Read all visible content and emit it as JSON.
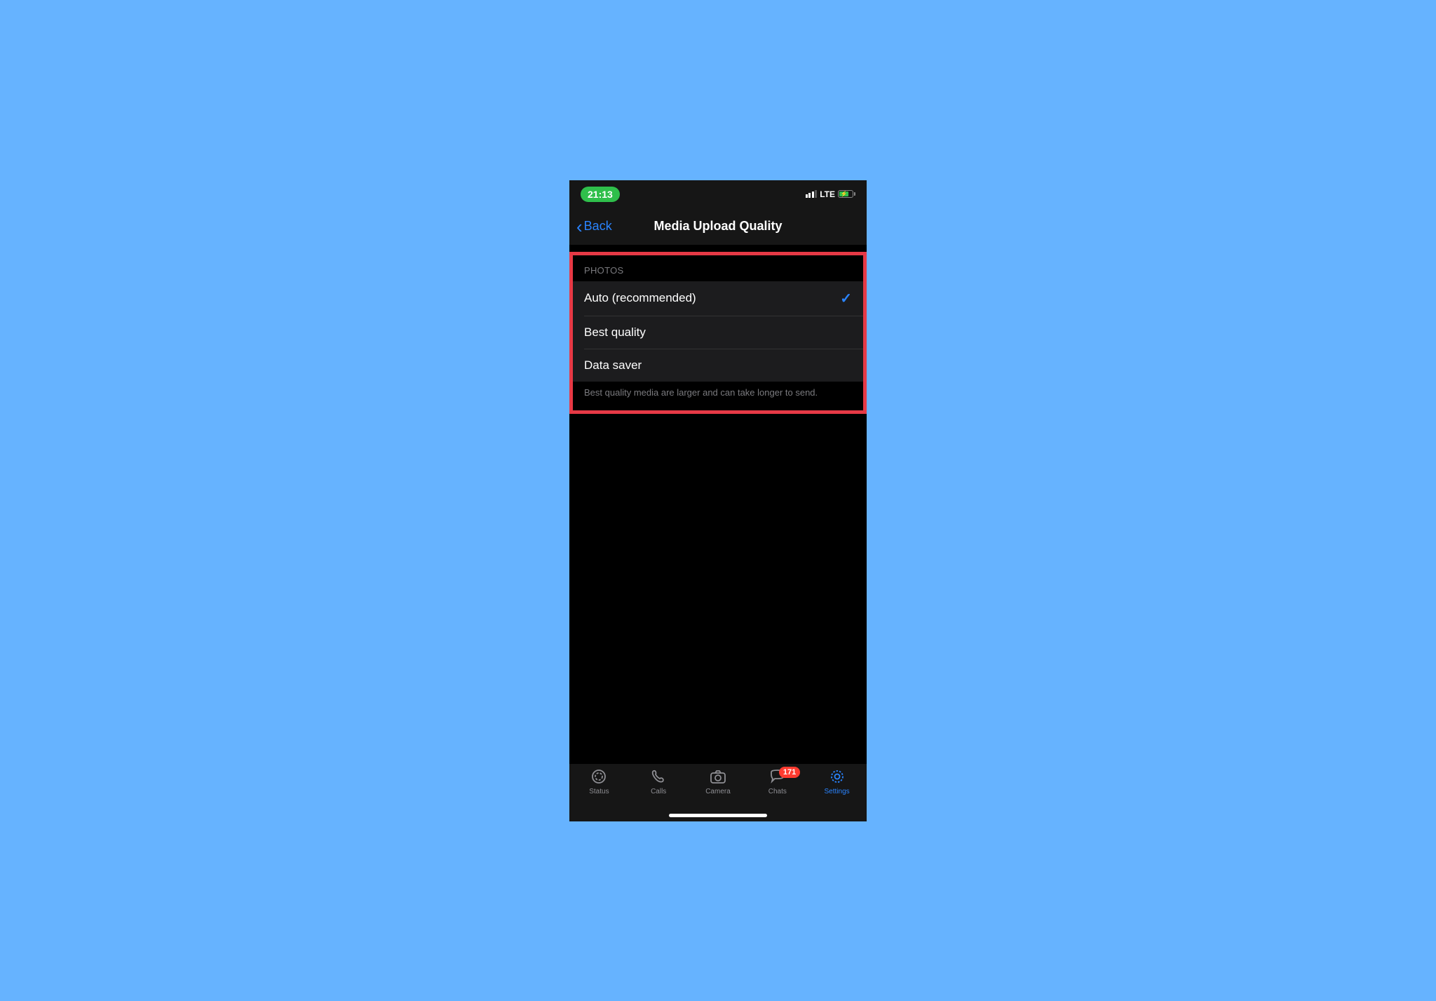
{
  "status": {
    "time": "21:13",
    "network": "LTE"
  },
  "nav": {
    "back_label": "Back",
    "title": "Media Upload Quality"
  },
  "section": {
    "header": "PHOTOS",
    "options": [
      {
        "label": "Auto (recommended)",
        "selected": true
      },
      {
        "label": "Best quality",
        "selected": false
      },
      {
        "label": "Data saver",
        "selected": false
      }
    ],
    "footer": "Best quality media are larger and can take longer to send."
  },
  "tabs": {
    "items": [
      {
        "label": "Status",
        "active": false
      },
      {
        "label": "Calls",
        "active": false
      },
      {
        "label": "Camera",
        "active": false
      },
      {
        "label": "Chats",
        "active": false,
        "badge": "171"
      },
      {
        "label": "Settings",
        "active": true
      }
    ]
  }
}
